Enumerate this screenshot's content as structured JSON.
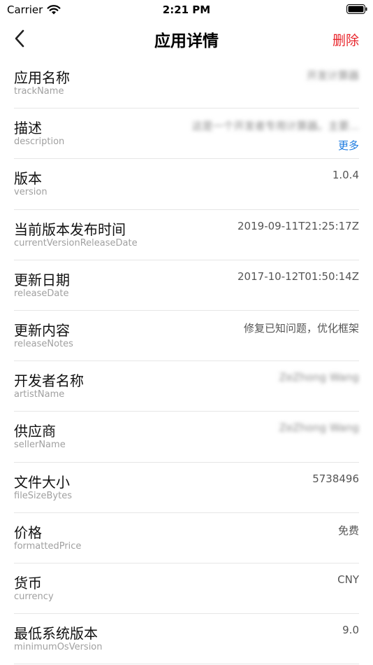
{
  "status": {
    "carrier": "Carrier",
    "time": "2:21 PM"
  },
  "nav": {
    "title": "应用详情",
    "delete_label": "删除"
  },
  "rows": [
    {
      "title": "应用名称",
      "key": "trackName",
      "value": "开发计算器",
      "blurred": true
    },
    {
      "title": "描述",
      "key": "description",
      "value": "这是一个开发者专用计算器。主要...",
      "blurred": true,
      "more": "更多"
    },
    {
      "title": "版本",
      "key": "version",
      "value": "1.0.4"
    },
    {
      "title": "当前版本发布时间",
      "key": "currentVersionReleaseDate",
      "value": "2019-09-11T21:25:17Z"
    },
    {
      "title": "更新日期",
      "key": "releaseDate",
      "value": "2017-10-12T01:50:14Z"
    },
    {
      "title": "更新内容",
      "key": "releaseNotes",
      "value": "修复已知问题，优化框架"
    },
    {
      "title": "开发者名称",
      "key": "artistName",
      "value": "ZeZhong Wang",
      "blurred": true
    },
    {
      "title": "供应商",
      "key": "sellerName",
      "value": "ZeZhong Wang",
      "blurred": true
    },
    {
      "title": "文件大小",
      "key": "fileSizeBytes",
      "value": "5738496"
    },
    {
      "title": "价格",
      "key": "formattedPrice",
      "value": "免费"
    },
    {
      "title": "货币",
      "key": "currency",
      "value": "CNY"
    },
    {
      "title": "最低系统版本",
      "key": "minimumOsVersion",
      "value": "9.0"
    }
  ],
  "icons": {
    "wifi": "wifi-icon",
    "battery": "battery-icon",
    "back": "chevron-left-icon"
  },
  "colors": {
    "accent_link": "#1d7be0",
    "delete": "#e8242a"
  }
}
